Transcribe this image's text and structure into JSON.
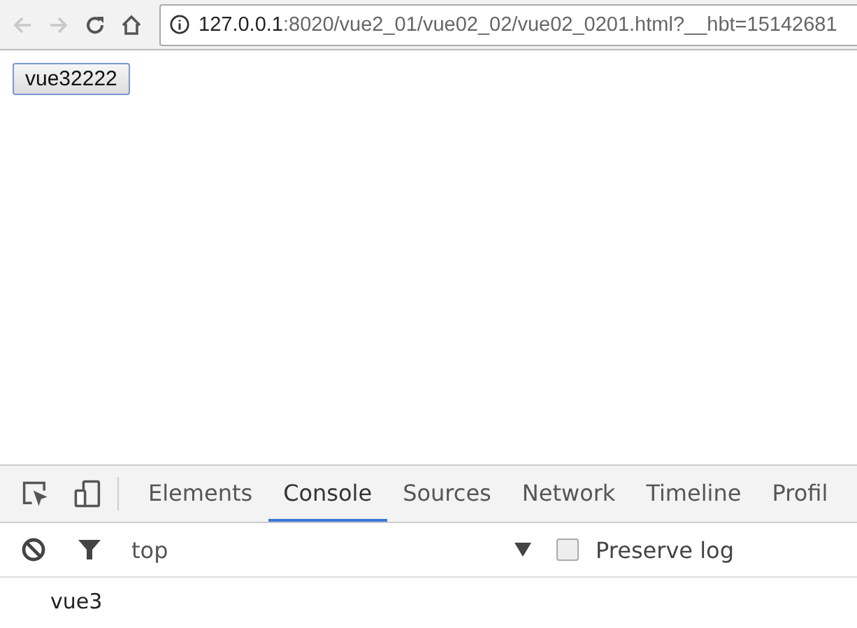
{
  "browser": {
    "back_disabled": true,
    "forward_disabled": true,
    "url_host": "127.0.0.1",
    "url_path": ":8020/vue2_01/vue02_02/vue02_0201.html?__hbt=15142681"
  },
  "page": {
    "button": "vue32222"
  },
  "devtools": {
    "tabs": [
      {
        "label": "Elements",
        "selected": false
      },
      {
        "label": "Console",
        "selected": true
      },
      {
        "label": "Sources",
        "selected": false
      },
      {
        "label": "Network",
        "selected": false
      },
      {
        "label": "Timeline",
        "selected": false
      },
      {
        "label": "Profil",
        "selected": false
      }
    ],
    "context": "top",
    "preserve_log": {
      "label": "Preserve log",
      "checked": false
    },
    "messages": [
      "vue3"
    ]
  }
}
